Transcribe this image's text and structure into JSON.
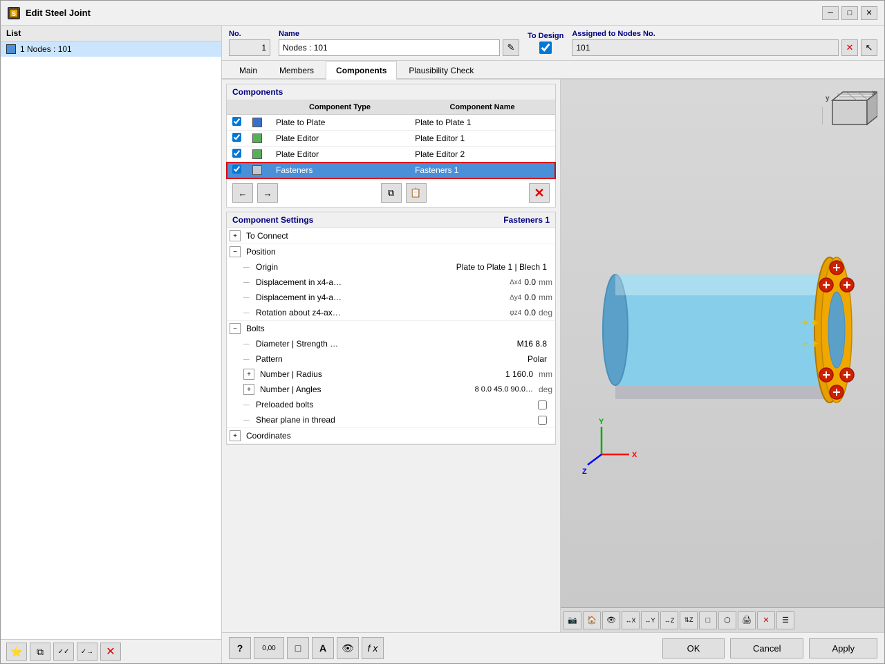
{
  "window": {
    "title": "Edit Steel Joint",
    "controls": [
      "minimize",
      "maximize",
      "close"
    ]
  },
  "header": {
    "list_label": "List",
    "no_label": "No.",
    "name_label": "Name",
    "to_design_label": "To Design",
    "assigned_label": "Assigned to Nodes No.",
    "no_value": "1",
    "name_value": "Nodes : 101",
    "assigned_value": "101"
  },
  "tabs": {
    "items": [
      "Main",
      "Members",
      "Components",
      "Plausibility Check"
    ],
    "active": "Components"
  },
  "list": {
    "header": "List",
    "items": [
      {
        "label": "1  Nodes : 101",
        "selected": true
      }
    ]
  },
  "components": {
    "section_title": "Components",
    "col_type": "Component Type",
    "col_name": "Component Name",
    "rows": [
      {
        "checked": true,
        "color": "blue",
        "type": "Plate to Plate",
        "name": "Plate to Plate 1",
        "selected": false
      },
      {
        "checked": true,
        "color": "green",
        "type": "Plate Editor",
        "name": "Plate Editor 1",
        "selected": false
      },
      {
        "checked": true,
        "color": "green",
        "type": "Plate Editor",
        "name": "Plate Editor 2",
        "selected": false
      },
      {
        "checked": true,
        "color": "light-gray",
        "type": "Fasteners",
        "name": "Fasteners 1",
        "selected": true
      }
    ],
    "toolbar_buttons": [
      "move-left",
      "move-right",
      "copy",
      "save"
    ],
    "delete_button": "×"
  },
  "settings": {
    "section_title": "Component Settings",
    "component_name": "Fasteners 1",
    "groups": [
      {
        "id": "to-connect",
        "label": "To Connect",
        "collapsed": true,
        "indent": 0,
        "children": []
      },
      {
        "id": "position",
        "label": "Position",
        "collapsed": false,
        "indent": 0,
        "children": [
          {
            "id": "origin",
            "label": "Origin",
            "symbol": "",
            "value": "Plate to Plate 1 | Blech 1",
            "unit": ""
          },
          {
            "id": "displacement-x",
            "label": "Displacement in x4-a…",
            "symbol": "Δx4",
            "value": "0.0",
            "unit": "mm"
          },
          {
            "id": "displacement-y",
            "label": "Displacement in y4-a…",
            "symbol": "Δy4",
            "value": "0.0",
            "unit": "mm"
          },
          {
            "id": "rotation",
            "label": "Rotation about z4-ax…",
            "symbol": "φz4",
            "value": "0.0",
            "unit": "deg"
          }
        ]
      },
      {
        "id": "bolts",
        "label": "Bolts",
        "collapsed": false,
        "indent": 0,
        "children": [
          {
            "id": "diameter",
            "label": "Diameter | Strength …",
            "symbol": "",
            "value": "M16   8.8",
            "unit": ""
          },
          {
            "id": "pattern",
            "label": "Pattern",
            "symbol": "",
            "value": "Polar",
            "unit": ""
          },
          {
            "id": "number-radius",
            "label": "Number | Radius",
            "symbol": "",
            "value": "1    160.0",
            "unit": "mm",
            "expandable": true
          },
          {
            "id": "number-angles",
            "label": "Number | Angles",
            "symbol": "",
            "value": "8    0.0 45.0 90.0…",
            "unit": "deg",
            "expandable": true
          },
          {
            "id": "preloaded",
            "label": "Preloaded bolts",
            "symbol": "",
            "value": "checkbox",
            "unit": ""
          },
          {
            "id": "shear-plane",
            "label": "Shear plane in thread",
            "symbol": "",
            "value": "checkbox",
            "unit": ""
          }
        ]
      },
      {
        "id": "coordinates",
        "label": "Coordinates",
        "collapsed": true,
        "indent": 0,
        "children": []
      }
    ]
  },
  "bottom_toolbar": {
    "buttons_left": [
      "star",
      "copy",
      "check-check",
      "check-arrow",
      "close-red"
    ],
    "buttons_right": [
      "help",
      "num",
      "square",
      "A",
      "eye",
      "fx"
    ]
  },
  "footer_buttons": {
    "ok": "OK",
    "cancel": "Cancel",
    "apply": "Apply"
  },
  "icons": {
    "minimize": "─",
    "maximize": "□",
    "close": "✕",
    "edit": "✎",
    "cursor": "↖",
    "arrow-left": "←",
    "arrow-right": "→",
    "copy": "⧉",
    "save": "💾",
    "delete": "✕",
    "expand": "+",
    "collapse": "−",
    "star": "⭐",
    "check": "✓",
    "eye": "👁",
    "help": "?",
    "num": "0,00"
  }
}
